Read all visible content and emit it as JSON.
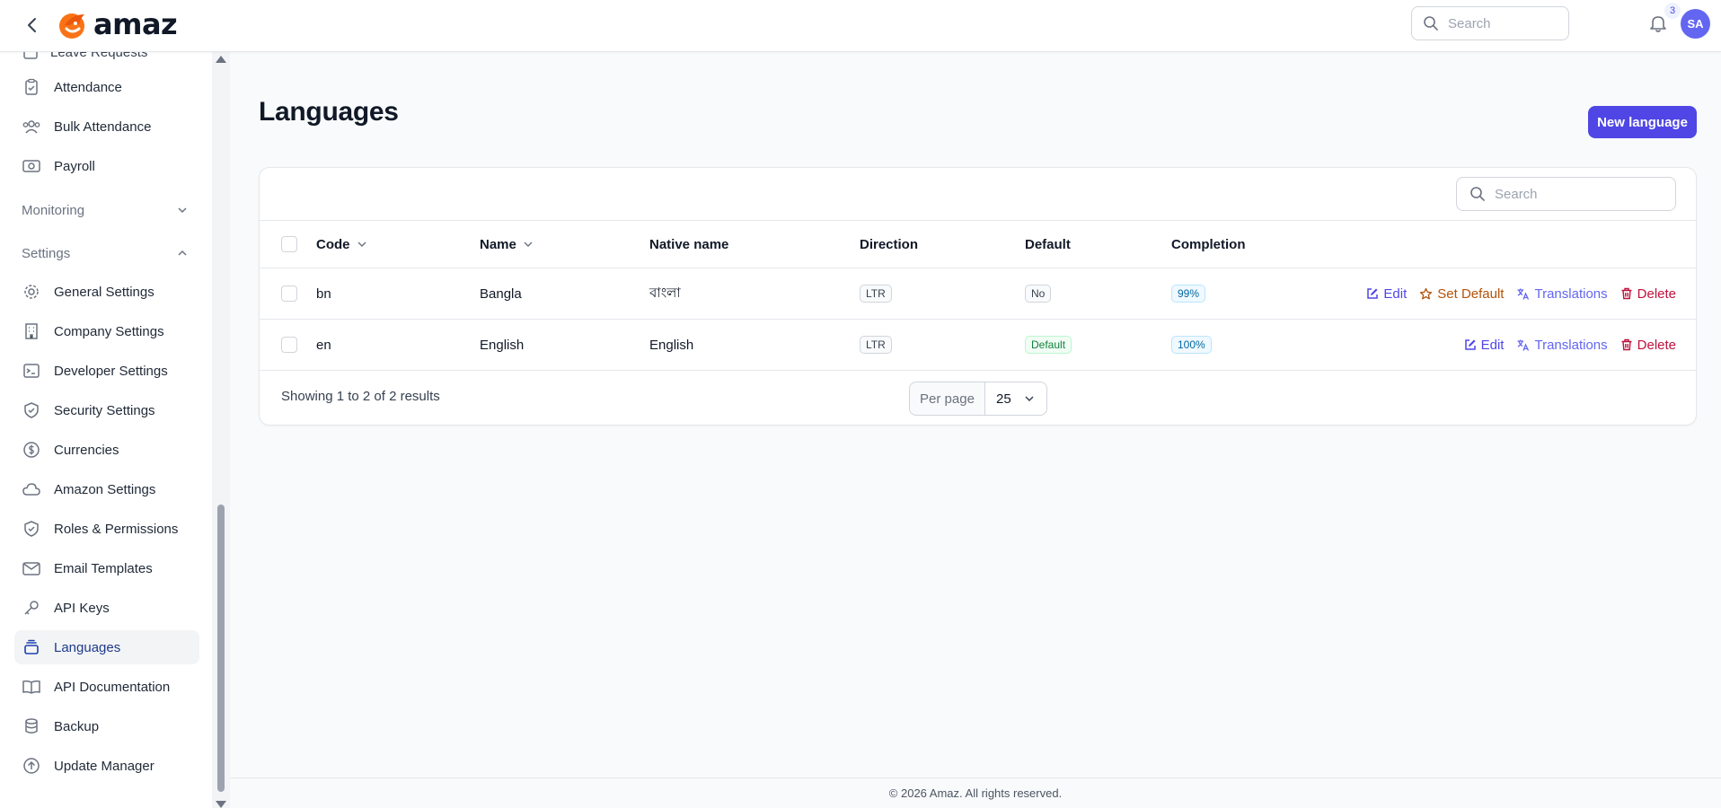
{
  "header": {
    "logo_text": "amaz",
    "search_placeholder": "Search",
    "notification_count": "3",
    "avatar_initials": "SA"
  },
  "sidebar": {
    "partial_item": "Leave Requests",
    "items_top": [
      {
        "label": "Attendance",
        "icon": "clipboard-check-icon"
      },
      {
        "label": "Bulk Attendance",
        "icon": "users-icon"
      },
      {
        "label": "Payroll",
        "icon": "banknotes-icon"
      }
    ],
    "groups": {
      "monitoring": "Monitoring",
      "settings": "Settings"
    },
    "settings_items": [
      {
        "label": "General Settings",
        "icon": "gear-icon"
      },
      {
        "label": "Company Settings",
        "icon": "building-icon"
      },
      {
        "label": "Developer Settings",
        "icon": "terminal-icon"
      },
      {
        "label": "Security Settings",
        "icon": "shield-icon"
      },
      {
        "label": "Currencies",
        "icon": "dollar-circle-icon"
      },
      {
        "label": "Amazon Settings",
        "icon": "cloud-icon"
      },
      {
        "label": "Roles & Permissions",
        "icon": "shield-check-icon"
      },
      {
        "label": "Email Templates",
        "icon": "envelope-icon"
      },
      {
        "label": "API Keys",
        "icon": "key-icon"
      },
      {
        "label": "Languages",
        "icon": "stack-icon",
        "active": true
      },
      {
        "label": "API Documentation",
        "icon": "book-icon"
      },
      {
        "label": "Backup",
        "icon": "database-icon"
      },
      {
        "label": "Update Manager",
        "icon": "arrow-up-circle-icon"
      }
    ]
  },
  "page": {
    "title": "Languages",
    "new_button": "New language"
  },
  "table": {
    "search_placeholder": "Search",
    "columns": {
      "code": "Code",
      "name": "Name",
      "native_name": "Native name",
      "direction": "Direction",
      "default": "Default",
      "completion": "Completion"
    },
    "rows": [
      {
        "code": "bn",
        "name": "Bangla",
        "native_name": "বাংলা",
        "direction": "LTR",
        "default": "No",
        "completion": "99%",
        "actions": {
          "edit": "Edit",
          "set_default": "Set Default",
          "translations": "Translations",
          "delete": "Delete"
        }
      },
      {
        "code": "en",
        "name": "English",
        "native_name": "English",
        "direction": "LTR",
        "default": "Default",
        "completion": "100%",
        "actions": {
          "edit": "Edit",
          "translations": "Translations",
          "delete": "Delete"
        }
      }
    ],
    "showing": "Showing 1 to 2 of 2 results",
    "per_page_label": "Per page",
    "per_page_value": "25"
  },
  "footer": {
    "copyright": "© 2026 Amaz. All rights reserved."
  },
  "colors": {
    "primary": "#4f46e5",
    "avatar": "#6366f1",
    "set_default": "#b45309",
    "delete": "#be123c"
  }
}
